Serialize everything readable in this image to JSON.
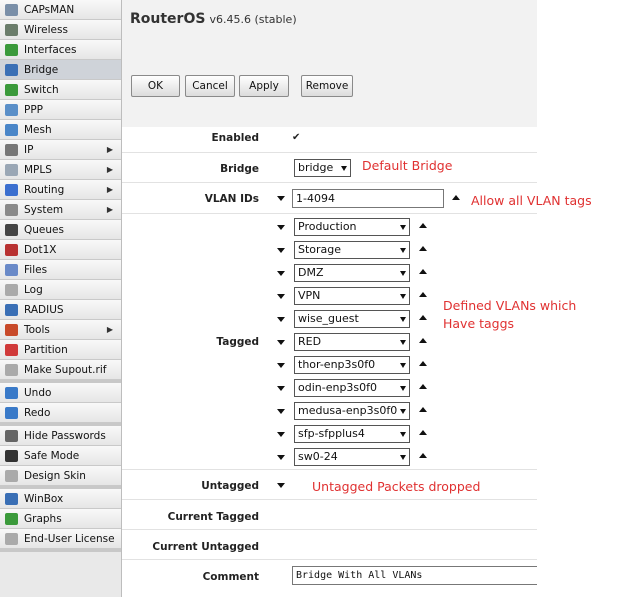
{
  "app": {
    "title": "RouterOS",
    "version": "v6.45.6 (stable)"
  },
  "sidebar": {
    "groups": [
      [
        {
          "label": "CAPsMAN",
          "icon": "capsman-icon",
          "color": "#7a8fa8"
        },
        {
          "label": "Wireless",
          "icon": "wireless-icon",
          "color": "#6b7d6b"
        },
        {
          "label": "Interfaces",
          "icon": "interfaces-icon",
          "color": "#3b9a3b"
        },
        {
          "label": "Bridge",
          "icon": "bridge-icon",
          "color": "#3a6fb5",
          "active": true
        },
        {
          "label": "Switch",
          "icon": "switch-icon",
          "color": "#3b9a3b"
        },
        {
          "label": "PPP",
          "icon": "ppp-icon",
          "color": "#5a8fc8"
        },
        {
          "label": "Mesh",
          "icon": "mesh-icon",
          "color": "#4a86c8"
        },
        {
          "label": "IP",
          "icon": "ip-icon",
          "color": "#777777",
          "submenu": true
        },
        {
          "label": "MPLS",
          "icon": "mpls-icon",
          "color": "#9aa7b5",
          "submenu": true
        },
        {
          "label": "Routing",
          "icon": "routing-icon",
          "color": "#3b6fcf",
          "submenu": true
        },
        {
          "label": "System",
          "icon": "system-icon",
          "color": "#8a8a8a",
          "submenu": true
        },
        {
          "label": "Queues",
          "icon": "queues-icon",
          "color": "#444444"
        },
        {
          "label": "Dot1X",
          "icon": "dot1x-icon",
          "color": "#b83232"
        },
        {
          "label": "Files",
          "icon": "files-icon",
          "color": "#6a8ac8"
        },
        {
          "label": "Log",
          "icon": "log-icon",
          "color": "#aaaaaa"
        },
        {
          "label": "RADIUS",
          "icon": "radius-icon",
          "color": "#3a6fb5"
        },
        {
          "label": "Tools",
          "icon": "tools-icon",
          "color": "#c84a2a",
          "submenu": true
        },
        {
          "label": "Partition",
          "icon": "partition-icon",
          "color": "#d03a3a"
        },
        {
          "label": "Make Supout.rif",
          "icon": "supout-icon",
          "color": "#aaaaaa"
        }
      ],
      [
        {
          "label": "Undo",
          "icon": "undo-icon",
          "color": "#3a7ac8"
        },
        {
          "label": "Redo",
          "icon": "redo-icon",
          "color": "#3a7ac8"
        }
      ],
      [
        {
          "label": "Hide Passwords",
          "icon": "hide-passwords-icon",
          "color": "#666666"
        },
        {
          "label": "Safe Mode",
          "icon": "safe-mode-icon",
          "color": "#333333"
        },
        {
          "label": "Design Skin",
          "icon": "design-skin-icon",
          "color": "#aaaaaa"
        }
      ],
      [
        {
          "label": "WinBox",
          "icon": "winbox-icon",
          "color": "#3a6fb5"
        },
        {
          "label": "Graphs",
          "icon": "graphs-icon",
          "color": "#3b9a3b"
        },
        {
          "label": "End-User License",
          "icon": "license-icon",
          "color": "#aaaaaa"
        }
      ]
    ]
  },
  "toolbar": {
    "ok": "OK",
    "cancel": "Cancel",
    "apply": "Apply",
    "remove": "Remove"
  },
  "form": {
    "enabled": {
      "label": "Enabled",
      "checked": true,
      "mark": "✔"
    },
    "bridge": {
      "label": "Bridge",
      "value": "bridge"
    },
    "vlan_ids": {
      "label": "VLAN IDs",
      "value": "1-4094"
    },
    "tagged": {
      "label": "Tagged",
      "items": [
        "Production",
        "Storage",
        "DMZ",
        "VPN",
        "wise_guest",
        "RED",
        "thor-enp3s0f0",
        "odin-enp3s0f0",
        "medusa-enp3s0f0",
        "sfp-sfpplus4",
        "sw0-24"
      ]
    },
    "untagged": {
      "label": "Untagged"
    },
    "current_tagged": {
      "label": "Current Tagged"
    },
    "current_untagged": {
      "label": "Current Untagged"
    },
    "comment": {
      "label": "Comment",
      "value": "Bridge With All VLANs"
    }
  },
  "annotations": {
    "default_bridge": "Default Bridge",
    "allow_all": "Allow all VLAN tags",
    "defined_1": "Defined VLANs which",
    "defined_2": "Have taggs",
    "untagged_dropped": "Untagged Packets dropped"
  },
  "colors": {
    "annotation": "#e03131",
    "sidebar_active": "#cfd3d9"
  }
}
